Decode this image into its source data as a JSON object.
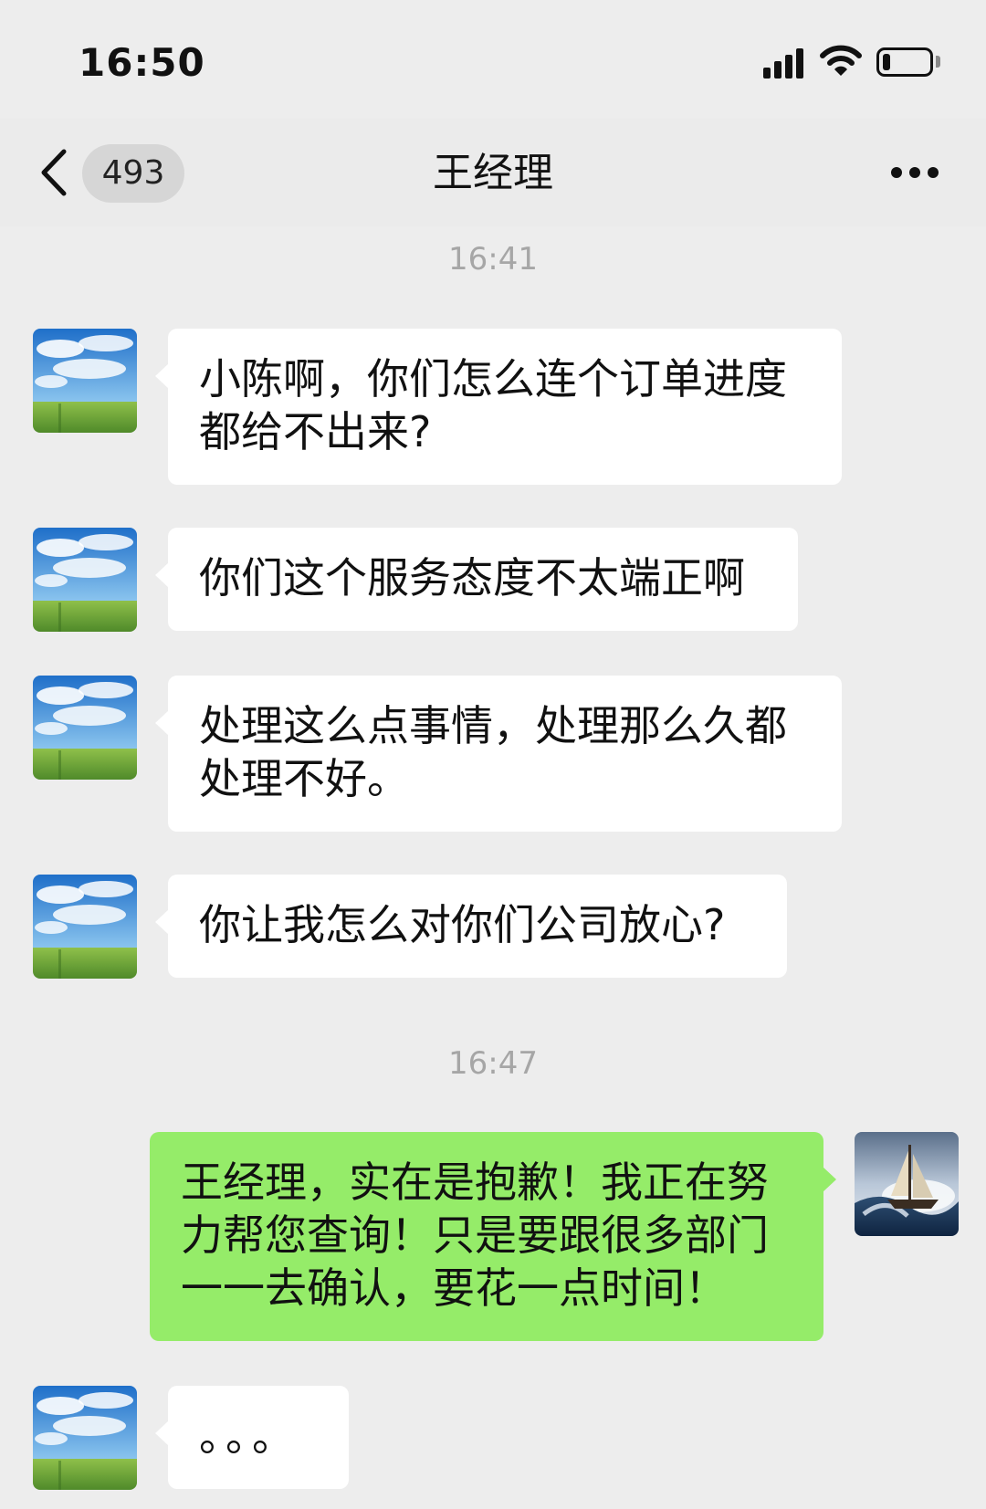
{
  "status_bar": {
    "time": "16:50",
    "icons": [
      "signal-icon",
      "wifi-icon",
      "battery-icon"
    ],
    "battery_level": 0.15
  },
  "nav": {
    "back_icon": "chevron-left-icon",
    "unread_count": "493",
    "title": "王经理",
    "more_icon": "more-dots-icon"
  },
  "timestamps": [
    "16:41",
    "16:47"
  ],
  "messages": [
    {
      "sender": "contact",
      "text": "小陈啊，你们怎么连个订单进度都给不出来?"
    },
    {
      "sender": "contact",
      "text": "你们这个服务态度不太端正啊"
    },
    {
      "sender": "contact",
      "text": "处理这么点事情，处理那么久都处理不好。"
    },
    {
      "sender": "contact",
      "text": "你让我怎么对你们公司放心?"
    },
    {
      "sender": "self",
      "text": "王经理，实在是抱歉！我正在努力帮您查询！只是要跟很多部门一一去确认，要花一点时间！"
    },
    {
      "sender": "contact",
      "text": "。。。"
    }
  ],
  "colors": {
    "background": "#ededed",
    "incoming_bubble": "#ffffff",
    "outgoing_bubble": "#95ec69",
    "timestamp": "#a6a6a6"
  }
}
